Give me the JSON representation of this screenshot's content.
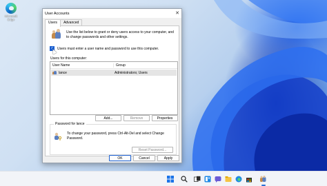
{
  "desktop": {
    "edge_icon_label": "Microsoft Edge"
  },
  "dialog": {
    "title": "User Accounts",
    "tabs": [
      "Users",
      "Advanced"
    ],
    "intro_text": "Use the list below to grant or deny users access to your computer, and to change passwords and other settings.",
    "checkbox_label": "Users must enter a user name and password to use this computer.",
    "checkbox_checked": true,
    "users_label": "Users for this computer:",
    "columns": [
      "User Name",
      "Group"
    ],
    "rows": [
      {
        "user": "lance",
        "group": "Administrators; Users"
      }
    ],
    "buttons": {
      "add": "Add...",
      "remove": "Remove",
      "properties": "Properties",
      "reset_password": "Reset Password...",
      "ok": "OK",
      "cancel": "Cancel",
      "apply": "Apply"
    },
    "password_group_title": "Password for lance",
    "password_text": "To change your password, press Ctrl-Alt-Del and select Change Password."
  },
  "colors": {
    "accent": "#1a5fd0",
    "wallpaper_blue": "#0a2fb0"
  }
}
